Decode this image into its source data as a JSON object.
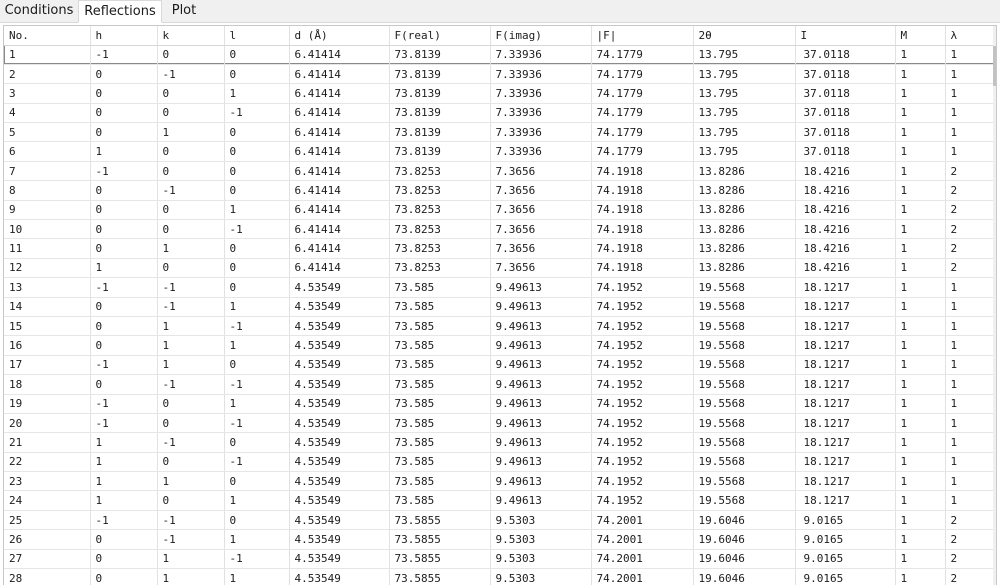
{
  "tabs": [
    {
      "label": "Conditions",
      "active": false
    },
    {
      "label": "Reflections",
      "active": true
    },
    {
      "label": "Plot",
      "active": false
    }
  ],
  "table": {
    "columns": [
      "No.",
      "h",
      "k",
      "l",
      "d (Å)",
      "F(real)",
      "F(imag)",
      "|F|",
      "2θ",
      "I",
      "M",
      "λ"
    ],
    "selected_row": 0,
    "rows": [
      [
        "1",
        "-1",
        "0",
        "0",
        "6.41414",
        "73.8139",
        "7.33936",
        "74.1779",
        "13.795",
        "37.0118",
        "1",
        "1"
      ],
      [
        "2",
        "0",
        "-1",
        "0",
        "6.41414",
        "73.8139",
        "7.33936",
        "74.1779",
        "13.795",
        "37.0118",
        "1",
        "1"
      ],
      [
        "3",
        "0",
        "0",
        "1",
        "6.41414",
        "73.8139",
        "7.33936",
        "74.1779",
        "13.795",
        "37.0118",
        "1",
        "1"
      ],
      [
        "4",
        "0",
        "0",
        "-1",
        "6.41414",
        "73.8139",
        "7.33936",
        "74.1779",
        "13.795",
        "37.0118",
        "1",
        "1"
      ],
      [
        "5",
        "0",
        "1",
        "0",
        "6.41414",
        "73.8139",
        "7.33936",
        "74.1779",
        "13.795",
        "37.0118",
        "1",
        "1"
      ],
      [
        "6",
        "1",
        "0",
        "0",
        "6.41414",
        "73.8139",
        "7.33936",
        "74.1779",
        "13.795",
        "37.0118",
        "1",
        "1"
      ],
      [
        "7",
        "-1",
        "0",
        "0",
        "6.41414",
        "73.8253",
        "7.3656",
        "74.1918",
        "13.8286",
        "18.4216",
        "1",
        "2"
      ],
      [
        "8",
        "0",
        "-1",
        "0",
        "6.41414",
        "73.8253",
        "7.3656",
        "74.1918",
        "13.8286",
        "18.4216",
        "1",
        "2"
      ],
      [
        "9",
        "0",
        "0",
        "1",
        "6.41414",
        "73.8253",
        "7.3656",
        "74.1918",
        "13.8286",
        "18.4216",
        "1",
        "2"
      ],
      [
        "10",
        "0",
        "0",
        "-1",
        "6.41414",
        "73.8253",
        "7.3656",
        "74.1918",
        "13.8286",
        "18.4216",
        "1",
        "2"
      ],
      [
        "11",
        "0",
        "1",
        "0",
        "6.41414",
        "73.8253",
        "7.3656",
        "74.1918",
        "13.8286",
        "18.4216",
        "1",
        "2"
      ],
      [
        "12",
        "1",
        "0",
        "0",
        "6.41414",
        "73.8253",
        "7.3656",
        "74.1918",
        "13.8286",
        "18.4216",
        "1",
        "2"
      ],
      [
        "13",
        "-1",
        "-1",
        "0",
        "4.53549",
        "73.585",
        "9.49613",
        "74.1952",
        "19.5568",
        "18.1217",
        "1",
        "1"
      ],
      [
        "14",
        "0",
        "-1",
        "1",
        "4.53549",
        "73.585",
        "9.49613",
        "74.1952",
        "19.5568",
        "18.1217",
        "1",
        "1"
      ],
      [
        "15",
        "0",
        "1",
        "-1",
        "4.53549",
        "73.585",
        "9.49613",
        "74.1952",
        "19.5568",
        "18.1217",
        "1",
        "1"
      ],
      [
        "16",
        "0",
        "1",
        "1",
        "4.53549",
        "73.585",
        "9.49613",
        "74.1952",
        "19.5568",
        "18.1217",
        "1",
        "1"
      ],
      [
        "17",
        "-1",
        "1",
        "0",
        "4.53549",
        "73.585",
        "9.49613",
        "74.1952",
        "19.5568",
        "18.1217",
        "1",
        "1"
      ],
      [
        "18",
        "0",
        "-1",
        "-1",
        "4.53549",
        "73.585",
        "9.49613",
        "74.1952",
        "19.5568",
        "18.1217",
        "1",
        "1"
      ],
      [
        "19",
        "-1",
        "0",
        "1",
        "4.53549",
        "73.585",
        "9.49613",
        "74.1952",
        "19.5568",
        "18.1217",
        "1",
        "1"
      ],
      [
        "20",
        "-1",
        "0",
        "-1",
        "4.53549",
        "73.585",
        "9.49613",
        "74.1952",
        "19.5568",
        "18.1217",
        "1",
        "1"
      ],
      [
        "21",
        "1",
        "-1",
        "0",
        "4.53549",
        "73.585",
        "9.49613",
        "74.1952",
        "19.5568",
        "18.1217",
        "1",
        "1"
      ],
      [
        "22",
        "1",
        "0",
        "-1",
        "4.53549",
        "73.585",
        "9.49613",
        "74.1952",
        "19.5568",
        "18.1217",
        "1",
        "1"
      ],
      [
        "23",
        "1",
        "1",
        "0",
        "4.53549",
        "73.585",
        "9.49613",
        "74.1952",
        "19.5568",
        "18.1217",
        "1",
        "1"
      ],
      [
        "24",
        "1",
        "0",
        "1",
        "4.53549",
        "73.585",
        "9.49613",
        "74.1952",
        "19.5568",
        "18.1217",
        "1",
        "1"
      ],
      [
        "25",
        "-1",
        "-1",
        "0",
        "4.53549",
        "73.5855",
        "9.5303",
        "74.2001",
        "19.6046",
        "9.0165",
        "1",
        "2"
      ],
      [
        "26",
        "0",
        "-1",
        "1",
        "4.53549",
        "73.5855",
        "9.5303",
        "74.2001",
        "19.6046",
        "9.0165",
        "1",
        "2"
      ],
      [
        "27",
        "0",
        "1",
        "-1",
        "4.53549",
        "73.5855",
        "9.5303",
        "74.2001",
        "19.6046",
        "9.0165",
        "1",
        "2"
      ],
      [
        "28",
        "0",
        "1",
        "1",
        "4.53549",
        "73.5855",
        "9.5303",
        "74.2001",
        "19.6046",
        "9.0165",
        "1",
        "2"
      ]
    ]
  }
}
